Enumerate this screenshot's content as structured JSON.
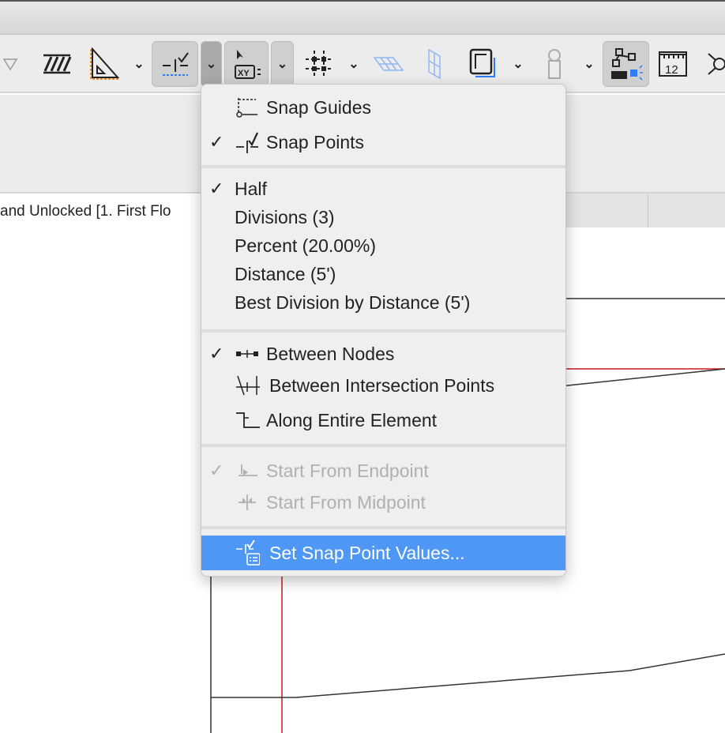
{
  "toolbar": {
    "buttons": [
      "triangle-dropdown",
      "hatch-fill",
      "angle-ruler",
      "snap-points",
      "coordinate-input",
      "grid-snap",
      "plane-horizontal",
      "plane-vertical",
      "frame",
      "figure",
      "cursor-snap",
      "dimension-ruler",
      "more"
    ],
    "ruler_label": "12",
    "coord_label": "XY"
  },
  "tab": {
    "title": "and Unlocked [1. First Flo"
  },
  "menu": {
    "items": [
      {
        "label": "Snap Guides",
        "checked": false,
        "icon": "snap-guides-icon"
      },
      {
        "label": "Snap Points",
        "checked": true,
        "icon": "snap-points-icon"
      },
      {
        "label": "Half",
        "checked": true
      },
      {
        "label": "Divisions (3)",
        "checked": false
      },
      {
        "label": "Percent (20.00%)",
        "checked": false
      },
      {
        "label": "Distance (5')",
        "checked": false
      },
      {
        "label": "Best Division by Distance (5')",
        "checked": false
      },
      {
        "label": "Between Nodes",
        "checked": true,
        "icon": "between-nodes-icon"
      },
      {
        "label": "Between Intersection Points",
        "checked": false,
        "icon": "intersection-icon"
      },
      {
        "label": "Along Entire Element",
        "checked": false,
        "icon": "along-element-icon"
      },
      {
        "label": "Start From Endpoint",
        "checked": true,
        "disabled": true,
        "icon": "endpoint-icon"
      },
      {
        "label": "Start From Midpoint",
        "checked": false,
        "disabled": true,
        "icon": "midpoint-icon"
      },
      {
        "label": "Set Snap Point Values...",
        "checked": false,
        "highlighted": true,
        "icon": "snap-values-icon"
      }
    ],
    "check_glyph": "✓"
  },
  "colors": {
    "highlight": "#4f97f5",
    "accent_blue": "#2f7cf6",
    "accent_orange": "#f08a1c",
    "red_line": "#c8181e"
  }
}
